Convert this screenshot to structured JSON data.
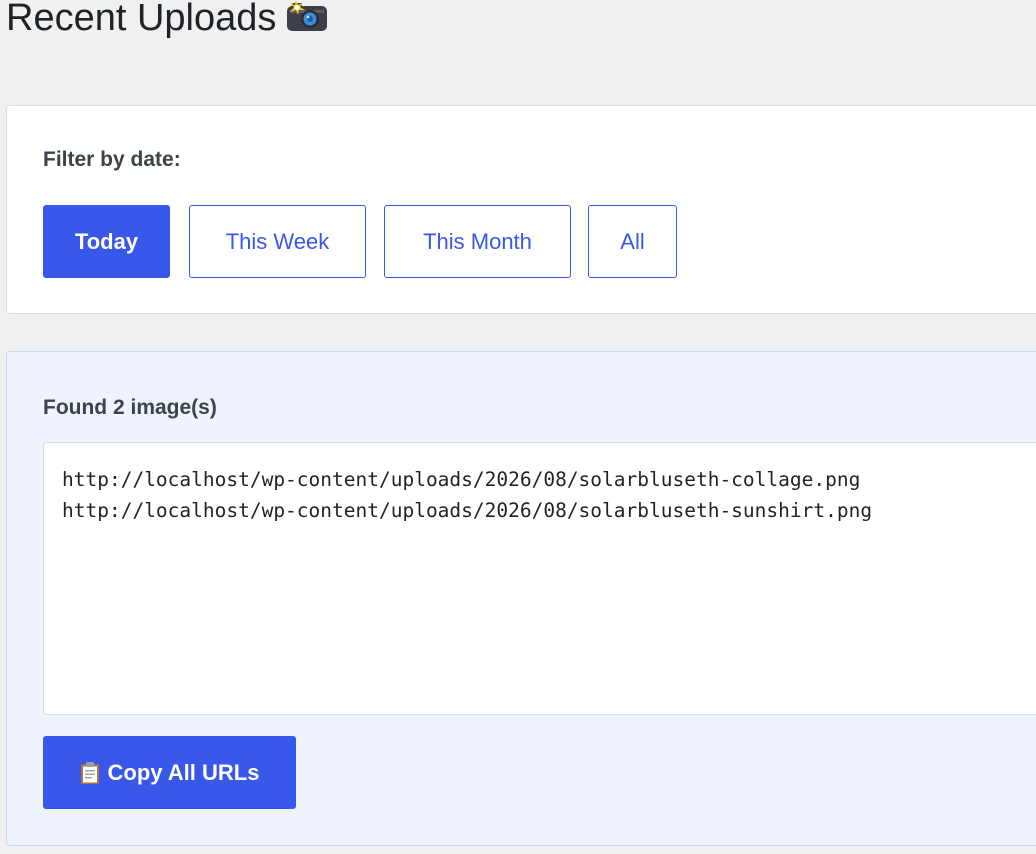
{
  "header": {
    "title": "Recent Uploads",
    "title_icon": "camera-flash-icon"
  },
  "filter": {
    "label": "Filter by date:",
    "buttons": [
      {
        "label": "Today",
        "active": true
      },
      {
        "label": "This Week",
        "active": false
      },
      {
        "label": "This Month",
        "active": false
      },
      {
        "label": "All",
        "active": false
      }
    ]
  },
  "results": {
    "count_text": "Found 2 image(s)",
    "urls": "http://localhost/wp-content/uploads/2026/08/solarbluseth-collage.png\nhttp://localhost/wp-content/uploads/2026/08/solarbluseth-sunshirt.png",
    "copy_button_label": "Copy All URLs",
    "copy_button_icon": "clipboard-icon"
  },
  "colors": {
    "accent": "#3858e9",
    "page_bg": "#f0f0f1",
    "results_bg": "#eef3fd"
  }
}
